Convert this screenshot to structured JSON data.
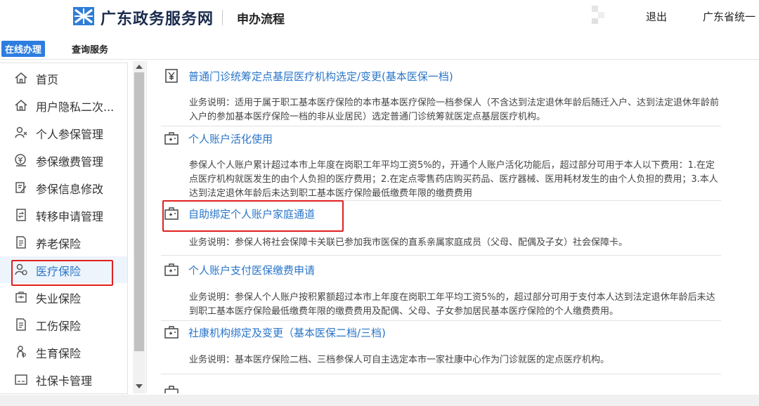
{
  "header": {
    "brand": "广东政务服务网",
    "page_title": "申办流程",
    "logout": "退出",
    "region": "广东省统一"
  },
  "tabs": [
    {
      "label": "在线办理",
      "active": true
    },
    {
      "label": "查询服务",
      "active": false
    }
  ],
  "sidebar": {
    "items": [
      {
        "label": "首页",
        "icon": "home-icon"
      },
      {
        "label": "用户隐私二次...",
        "icon": "home-icon"
      },
      {
        "label": "个人参保管理",
        "icon": "person-icon"
      },
      {
        "label": "参保缴费管理",
        "icon": "coin-icon"
      },
      {
        "label": "参保信息修改",
        "icon": "edit-icon"
      },
      {
        "label": "转移申请管理",
        "icon": "transfer-icon"
      },
      {
        "label": "养老保险",
        "icon": "document-icon"
      },
      {
        "label": "医疗保险",
        "icon": "medical-person-icon",
        "active": true
      },
      {
        "label": "失业保险",
        "icon": "briefcase-icon"
      },
      {
        "label": "工伤保险",
        "icon": "document-icon"
      },
      {
        "label": "生育保险",
        "icon": "baby-icon"
      },
      {
        "label": "社保卡管理",
        "icon": "card-icon"
      }
    ]
  },
  "services": [
    {
      "title": "普通门诊统筹定点基层医疗机构选定/变更(基本医保一档)",
      "icon": "yen-icon",
      "desc": "业务说明：适用于属于职工基本医疗保险的本市基本医疗保险一档参保人（不含达到法定退休年龄后随迁入户、达到法定退休年龄前入户的参加基本医疗保险一档的非从业居民）选定普通门诊统筹就医定点基层医疗机构。"
    },
    {
      "title": "个人账户活化使用",
      "icon": "medical-kit-icon",
      "desc": "参保人个人账户累计超过本市上年度在岗职工年平均工资5%的，开通个人账户活化功能后，超过部分可用于本人以下费用：1.在定点医疗机构就医发生的由个人负担的医疗费用；2.在定点零售药店购买药品、医疗器械、医用耗材发生的由个人负担的费用；3.本人达到法定退休年龄后未达到职工基本医疗保险最低缴费年限的缴费费用"
    },
    {
      "title": "自助绑定个人账户家庭通道",
      "icon": "medical-kit-icon",
      "desc": "业务说明：参保人将社会保障卡关联已参加我市医保的直系亲属家庭成员（父母、配偶及子女）社会保障卡。"
    },
    {
      "title": "个人账户支付医保缴费申请",
      "icon": "medical-kit-icon",
      "desc": "业务说明：参保人个人账户按积累额超过本市上年度在岗职工年平均工资5%的，超过部分可用于支付本人达到法定退休年龄后未达到职工基本医疗保险最低缴费年限的缴费费用及配偶、父母、子女参加居民基本医疗保险的个人缴费费用。"
    },
    {
      "title": "社康机构绑定及变更（基本医保二档/三档)",
      "icon": "medical-kit-icon",
      "desc": "业务说明：基本医疗保险二档、三档参保人可自主选定本市一家社康中心作为门诊就医的定点医疗机构。"
    }
  ],
  "colors": {
    "accent": "#2a76c9",
    "tab_active_bg": "#2d7de0",
    "highlight_border": "#e02020"
  }
}
